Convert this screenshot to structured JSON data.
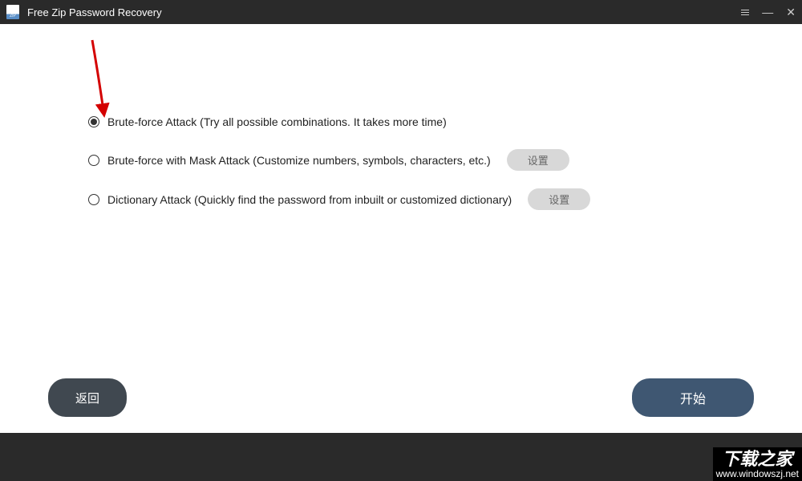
{
  "titlebar": {
    "title": "Free Zip Password Recovery"
  },
  "options": {
    "brute_force": {
      "label": "Brute-force Attack (Try all possible combinations. It takes more time)",
      "selected": true
    },
    "mask": {
      "label": "Brute-force with Mask Attack (Customize numbers, symbols, characters, etc.)",
      "selected": false,
      "settings_label": "设置"
    },
    "dictionary": {
      "label": "Dictionary Attack (Quickly find the password from inbuilt or customized dictionary)",
      "selected": false,
      "settings_label": "设置"
    }
  },
  "buttons": {
    "back": "返回",
    "start": "开始"
  },
  "watermark": {
    "line1": "下载之家",
    "line2": "www.windowszj.net"
  }
}
